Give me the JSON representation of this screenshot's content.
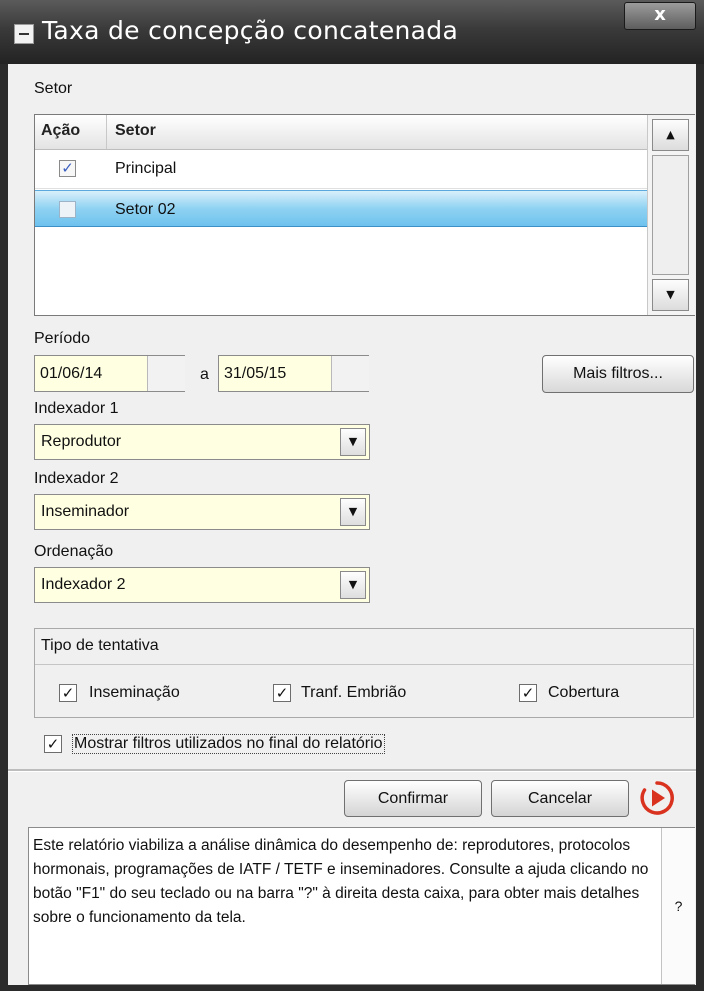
{
  "window": {
    "title": "Taxa de concepção concatenada",
    "close_label": "x"
  },
  "setor": {
    "section_label": "Setor",
    "columns": [
      "Ação",
      "Setor"
    ],
    "rows": [
      {
        "checked": true,
        "check_mark": "✓",
        "name": "Principal"
      },
      {
        "checked": false,
        "check_mark": "",
        "name": "Setor 02",
        "selected": true
      }
    ]
  },
  "periodo": {
    "label": "Período",
    "start": "01/06/14",
    "separator": "a",
    "end": "31/05/15"
  },
  "more_filters_label": "Mais filtros...",
  "indexador1": {
    "label": "Indexador 1",
    "value": "Reprodutor"
  },
  "indexador2": {
    "label": "Indexador 2",
    "value": "Inseminador"
  },
  "ordenacao": {
    "label": "Ordenação",
    "value": "Indexador 2"
  },
  "tipo_tentativa": {
    "title": "Tipo de tentativa",
    "options": [
      {
        "label": "Inseminação",
        "checked": true,
        "mark": "✓"
      },
      {
        "label": "Tranf. Embrião",
        "checked": true,
        "mark": "✓"
      },
      {
        "label": "Cobertura",
        "checked": true,
        "mark": "✓"
      }
    ]
  },
  "mostrar_filtros": {
    "label": "Mostrar filtros utilizados no final do relatório",
    "checked": true,
    "mark": "✓"
  },
  "buttons": {
    "confirm": "Confirmar",
    "cancel": "Cancelar"
  },
  "help": {
    "text": "Este relatório viabiliza a análise dinâmica do desempenho de: reprodutores, protocolos hormonais, programações de IATF / TETF e inseminadores. Consulte a ajuda clicando no botão \"F1\" do seu teclado ou na barra \"?\" à direita desta caixa, para obter mais detalhes sobre o funcionamento da tela.",
    "side_label": "?"
  },
  "icons": {
    "window_menu": "minus-box-icon",
    "close": "close-icon",
    "scroll_up": "triangle-up-icon",
    "scroll_down": "triangle-down-icon",
    "dropdown": "triangle-down-icon",
    "play": "play-circle-icon"
  },
  "colors": {
    "title_bar": "#3a3a3a",
    "input_bg": "#ffffe1",
    "selection": "#8fd2f2",
    "play_accent": "#d9321f",
    "checkbox_mark": "#3a5fc0"
  }
}
